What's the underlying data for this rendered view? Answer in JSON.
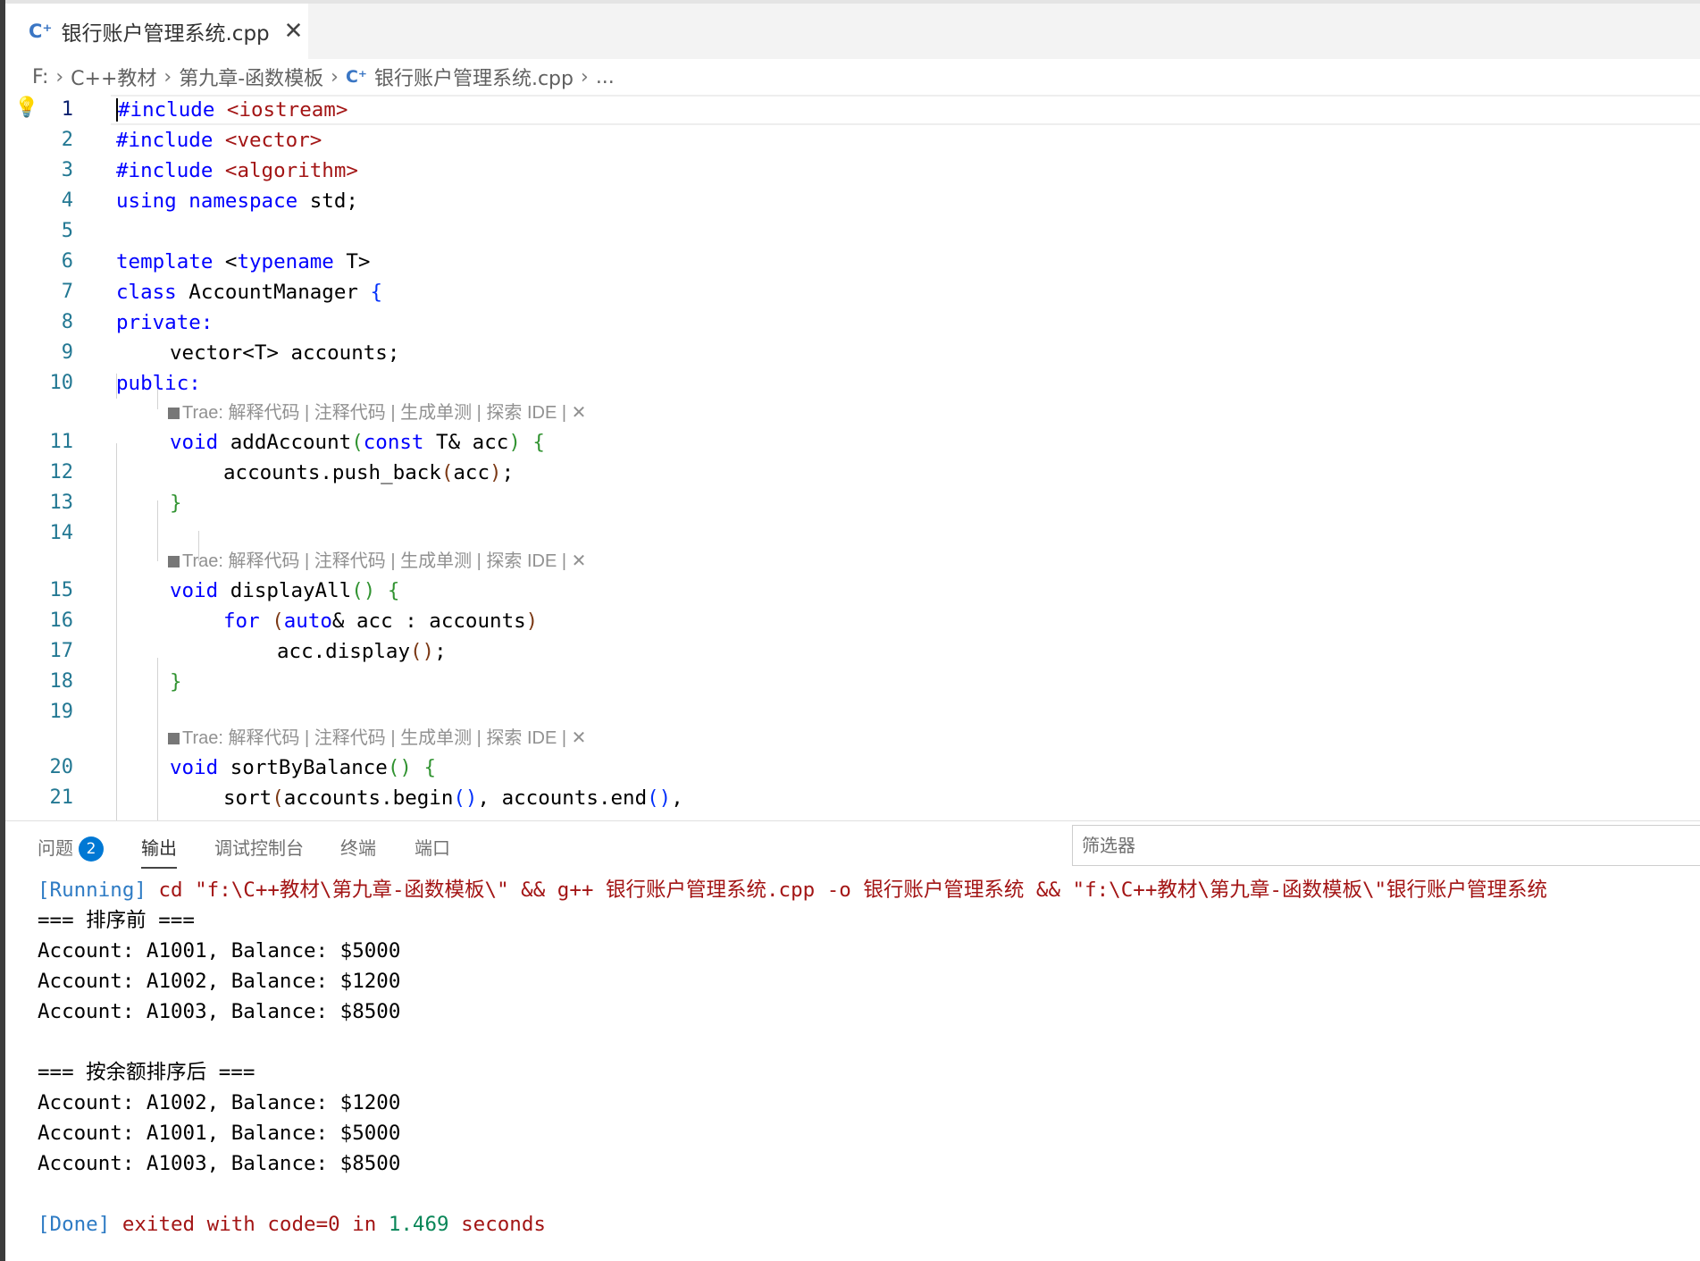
{
  "tab": {
    "filename": "银行账户管理系统.cpp",
    "close": "✕",
    "icon": "C⁺"
  },
  "breadcrumb": {
    "drive": "F:",
    "folder1": "C++教材",
    "folder2": "第九章-函数模板",
    "file": "银行账户管理系统.cpp",
    "more": "..."
  },
  "editor": {
    "lines": {
      "l1": {
        "num": "1",
        "directive": "#include",
        "header": "<iostream>"
      },
      "l2": {
        "num": "2",
        "directive": "#include",
        "header": "<vector>"
      },
      "l3": {
        "num": "3",
        "directive": "#include",
        "header": "<algorithm>"
      },
      "l4": {
        "num": "4",
        "kw1": "using",
        "kw2": "namespace",
        "rest": " std;"
      },
      "l5": {
        "num": "5"
      },
      "l6": {
        "num": "6",
        "kw1": "template",
        "lt": " <",
        "kw2": "typename",
        "rest": " T>"
      },
      "l7": {
        "num": "7",
        "kw1": "class",
        "rest": " AccountManager ",
        "brace": "{"
      },
      "l8": {
        "num": "8",
        "kw1": "private:"
      },
      "l9": {
        "num": "9",
        "rest": "vector<T> accounts;"
      },
      "l10": {
        "num": "10",
        "kw1": "public:"
      },
      "l11": {
        "num": "11",
        "kw1": "void",
        "name": " addAccount",
        "p1": "(",
        "kw2": "const",
        "mid": " T& acc",
        "p2": ")",
        "sp": " ",
        "brace": "{"
      },
      "l12": {
        "num": "12",
        "a": "accounts.push_back",
        "p1": "(",
        "b": "acc",
        "p2": ")",
        "c": ";"
      },
      "l13": {
        "num": "13",
        "brace": "}"
      },
      "l14": {
        "num": "14"
      },
      "l15": {
        "num": "15",
        "kw1": "void",
        "name": " displayAll",
        "p": "()",
        "sp": " ",
        "brace": "{"
      },
      "l16": {
        "num": "16",
        "kw1": "for",
        "sp": " ",
        "p1": "(",
        "kw2": "auto",
        "mid": "& acc : accounts",
        "p2": ")"
      },
      "l17": {
        "num": "17",
        "a": "acc.display",
        "p": "()",
        "c": ";"
      },
      "l18": {
        "num": "18",
        "brace": "}"
      },
      "l19": {
        "num": "19"
      },
      "l20": {
        "num": "20",
        "kw1": "void",
        "name": " sortByBalance",
        "p": "()",
        "sp": " ",
        "brace": "{"
      },
      "l21": {
        "num": "21",
        "a": "sort",
        "p1": "(",
        "b": "accounts.begin",
        "p2": "()",
        "c": ", accounts.end",
        "p3": "()",
        "d": ","
      }
    },
    "codelens": "Trae: 解释代码 | 注释代码 | 生成单测 | 探索 IDE | ✕"
  },
  "panel": {
    "tabs": {
      "problems": "问题",
      "problems_count": "2",
      "output": "输出",
      "debug": "调试控制台",
      "terminal": "终端",
      "ports": "端口"
    },
    "filter_placeholder": "筛选器",
    "output": {
      "run_tag": "[Running]",
      "run_cmd": " cd \"f:\\C++教材\\第九章-函数模板\\\" && g++ 银行账户管理系统.cpp -o 银行账户管理系统 && \"f:\\C++教材\\第九章-函数模板\\\"银行账户管理系统",
      "before_header": "=== 排序前 ===",
      "before": [
        "Account: A1001, Balance: $5000",
        "Account: A1002, Balance: $1200",
        "Account: A1003, Balance: $8500"
      ],
      "after_header": "=== 按余额排序后 ===",
      "after": [
        "Account: A1002, Balance: $1200",
        "Account: A1001, Balance: $5000",
        "Account: A1003, Balance: $8500"
      ],
      "done_tag": "[Done]",
      "done_a": " exited with code=0 in ",
      "done_time": "1.469",
      "done_b": " seconds"
    }
  }
}
